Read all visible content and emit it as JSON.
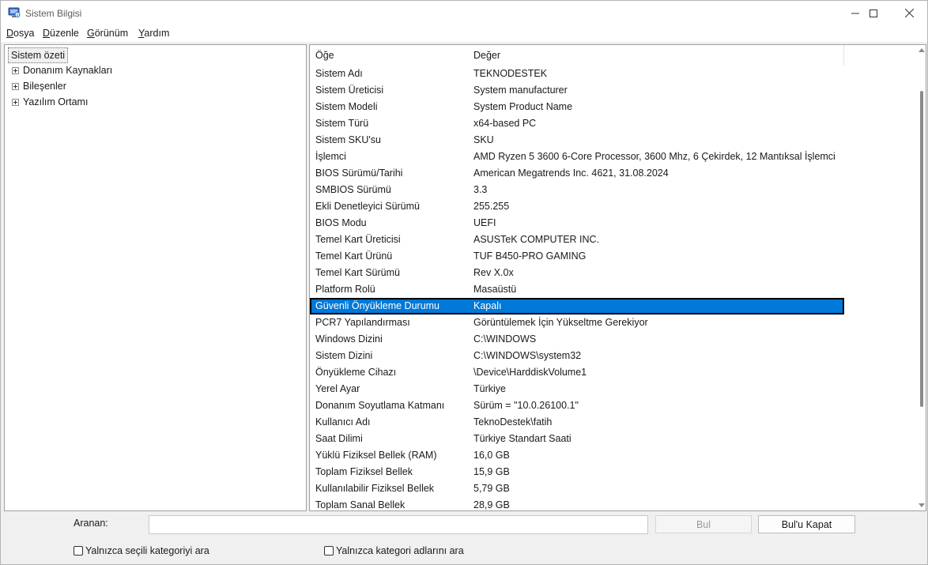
{
  "window": {
    "title": "Sistem Bilgisi",
    "controls": {
      "minimize": "—",
      "maximize": "☐",
      "close": "✕"
    }
  },
  "menu": [
    {
      "label": "Dosya"
    },
    {
      "label": "Düzenle"
    },
    {
      "label": "Görünüm"
    },
    {
      "label": "Yardım"
    }
  ],
  "tree": {
    "root": "Sistem özeti",
    "children": [
      "Donanım Kaynakları",
      "Bileşenler",
      "Yazılım Ortamı"
    ]
  },
  "table": {
    "columns": [
      "Öğe",
      "Değer"
    ],
    "selected_index": 14,
    "rows": [
      [
        "Sistem Adı",
        "TEKNODESTEK"
      ],
      [
        "Sistem Üreticisi",
        "System manufacturer"
      ],
      [
        "Sistem Modeli",
        "System Product Name"
      ],
      [
        "Sistem Türü",
        "x64-based PC"
      ],
      [
        "Sistem SKU'su",
        "SKU"
      ],
      [
        "İşlemci",
        "AMD Ryzen 5 3600 6-Core Processor, 3600 Mhz, 6 Çekirdek, 12 Mantıksal İşlemci"
      ],
      [
        "BIOS Sürümü/Tarihi",
        "American Megatrends Inc. 4621, 31.08.2024"
      ],
      [
        "SMBIOS Sürümü",
        "3.3"
      ],
      [
        "Ekli Denetleyici Sürümü",
        "255.255"
      ],
      [
        "BIOS Modu",
        "UEFI"
      ],
      [
        "Temel Kart Üreticisi",
        "ASUSTeK COMPUTER INC."
      ],
      [
        "Temel Kart Ürünü",
        "TUF B450-PRO GAMING"
      ],
      [
        "Temel Kart Sürümü",
        "Rev X.0x"
      ],
      [
        "Platform Rolü",
        "Masaüstü"
      ],
      [
        "Güvenli Önyükleme Durumu",
        "Kapalı"
      ],
      [
        "PCR7 Yapılandırması",
        "Görüntülemek İçin Yükseltme Gerekiyor"
      ],
      [
        "Windows Dizini",
        "C:\\WINDOWS"
      ],
      [
        "Sistem Dizini",
        "C:\\WINDOWS\\system32"
      ],
      [
        "Önyükleme Cihazı",
        "\\Device\\HarddiskVolume1"
      ],
      [
        "Yerel Ayar",
        "Türkiye"
      ],
      [
        "Donanım Soyutlama Katmanı",
        "Sürüm = \"10.0.26100.1\""
      ],
      [
        "Kullanıcı Adı",
        "TeknoDestek\\fatih"
      ],
      [
        "Saat Dilimi",
        "Türkiye Standart Saati"
      ],
      [
        "Yüklü Fiziksel Bellek (RAM)",
        "16,0 GB"
      ],
      [
        "Toplam Fiziksel Bellek",
        "15,9 GB"
      ],
      [
        "Kullanılabilir Fiziksel Bellek",
        "5,79 GB"
      ],
      [
        "Toplam Sanal Bellek",
        "28,9 GB"
      ]
    ]
  },
  "search": {
    "label": "Aranan:",
    "value": "",
    "find_button": "Bul",
    "close_find_button": "Bul'u Kapat",
    "option_selected_category": "Yalnızca seçili kategoriyi ara",
    "option_category_names": "Yalnızca kategori adlarını ara"
  },
  "colors": {
    "selection": "#0078d7",
    "window_bg": "#f0f0f0"
  }
}
